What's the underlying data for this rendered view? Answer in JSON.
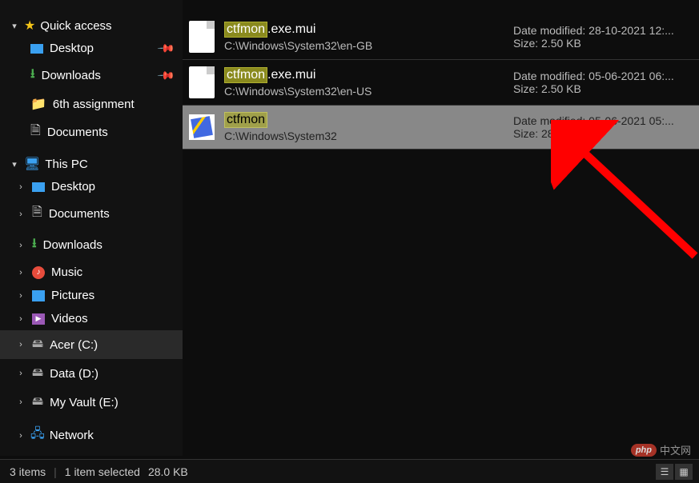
{
  "sidebar": {
    "quick_access": {
      "label": "Quick access",
      "items": [
        {
          "label": "Desktop",
          "icon": "desktop",
          "pinned": true
        },
        {
          "label": "Downloads",
          "icon": "download",
          "pinned": true
        },
        {
          "label": "6th assignment",
          "icon": "folder",
          "pinned": false
        },
        {
          "label": "Documents",
          "icon": "doc",
          "pinned": false
        }
      ]
    },
    "this_pc": {
      "label": "This PC",
      "items": [
        {
          "label": "Desktop",
          "icon": "desktop"
        },
        {
          "label": "Documents",
          "icon": "doc"
        },
        {
          "label": "Downloads",
          "icon": "download"
        },
        {
          "label": "Music",
          "icon": "music"
        },
        {
          "label": "Pictures",
          "icon": "pictures"
        },
        {
          "label": "Videos",
          "icon": "videos"
        },
        {
          "label": "Acer (C:)",
          "icon": "drive",
          "selected": true
        },
        {
          "label": "Data (D:)",
          "icon": "drive"
        },
        {
          "label": "My Vault (E:)",
          "icon": "drive"
        }
      ]
    },
    "network": {
      "label": "Network"
    }
  },
  "search_term": "ctfmon",
  "results": [
    {
      "name_prefix": "ctfmon",
      "name_suffix": ".exe.mui",
      "path": "C:\\Windows\\System32\\en-GB",
      "date_label": "Date modified:",
      "date_value": "28-10-2021 12:...",
      "size_label": "Size:",
      "size_value": "2.50 KB",
      "selected": false,
      "icon": "file"
    },
    {
      "name_prefix": "ctfmon",
      "name_suffix": ".exe.mui",
      "path": "C:\\Windows\\System32\\en-US",
      "date_label": "Date modified:",
      "date_value": "05-06-2021 06:...",
      "size_label": "Size:",
      "size_value": "2.50 KB",
      "selected": false,
      "icon": "file"
    },
    {
      "name_prefix": "ctfmon",
      "name_suffix": "",
      "path": "C:\\Windows\\System32",
      "date_label": "Date modified:",
      "date_value": "05-06-2021 05:...",
      "size_label": "Size:",
      "size_value": "28.0 KB",
      "selected": true,
      "icon": "app"
    }
  ],
  "statusbar": {
    "items_count": "3 items",
    "selected_count": "1 item selected",
    "selected_size": "28.0 KB"
  },
  "watermark": {
    "badge": "php",
    "text": "中文网"
  }
}
